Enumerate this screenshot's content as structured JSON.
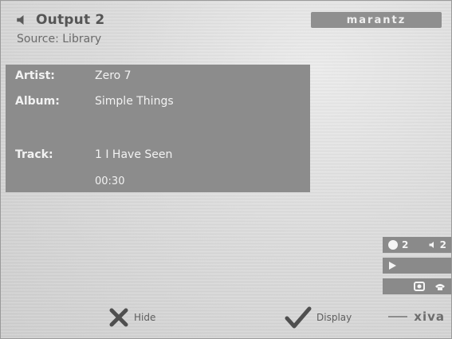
{
  "header": {
    "title": "Output 2",
    "source": "Source: Library"
  },
  "brand": {
    "logo_text": "marantz"
  },
  "now_playing": {
    "artist_label": "Artist:",
    "artist": "Zero 7",
    "album_label": "Album:",
    "album": "Simple Things",
    "track_label": "Track:",
    "track": "1   I Have Seen",
    "time": "00:30"
  },
  "side_controls": {
    "zone_a": "2",
    "zone_b": "2"
  },
  "buttons": {
    "hide_label": "Hide",
    "display_label": "Display"
  },
  "footer": {
    "xiva_text": "xiva"
  },
  "icons": {
    "speaker": "speaker-icon",
    "close": "x-icon",
    "check": "checkmark-icon",
    "play": "play-icon",
    "camera": "camera-icon",
    "phone": "phone-icon"
  },
  "colors": {
    "panel": "#8c8c8c",
    "text_dark": "#555555",
    "text_light": "#f2f2f2"
  }
}
